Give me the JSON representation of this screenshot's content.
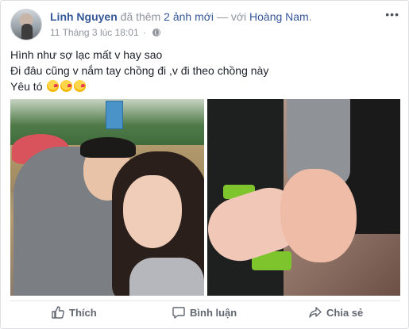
{
  "post": {
    "author": "Linh Nguyen",
    "action_text": "đã thêm",
    "photos_text": "2 ảnh mới",
    "separator": "— với",
    "tagged": "Hoàng Nam",
    "tagged_suffix": ".",
    "timestamp": "11 Tháng 3 lúc 18:01",
    "dot": "·",
    "privacy_icon": "globe-icon",
    "more_label": "•••",
    "text_lines": [
      "Hình như sợ lạc mất v hay sao",
      "Đi đâu cũng v nắm tay chồng đi ,v đi theo chồng này",
      "Yêu tó"
    ],
    "emoji_icon": "kissing-face-icon"
  },
  "actions": {
    "like_label": "Thích",
    "comment_label": "Bình luận",
    "share_label": "Chia sẻ"
  },
  "colors": {
    "link": "#365899",
    "meta": "#90949c",
    "action": "#616770"
  }
}
